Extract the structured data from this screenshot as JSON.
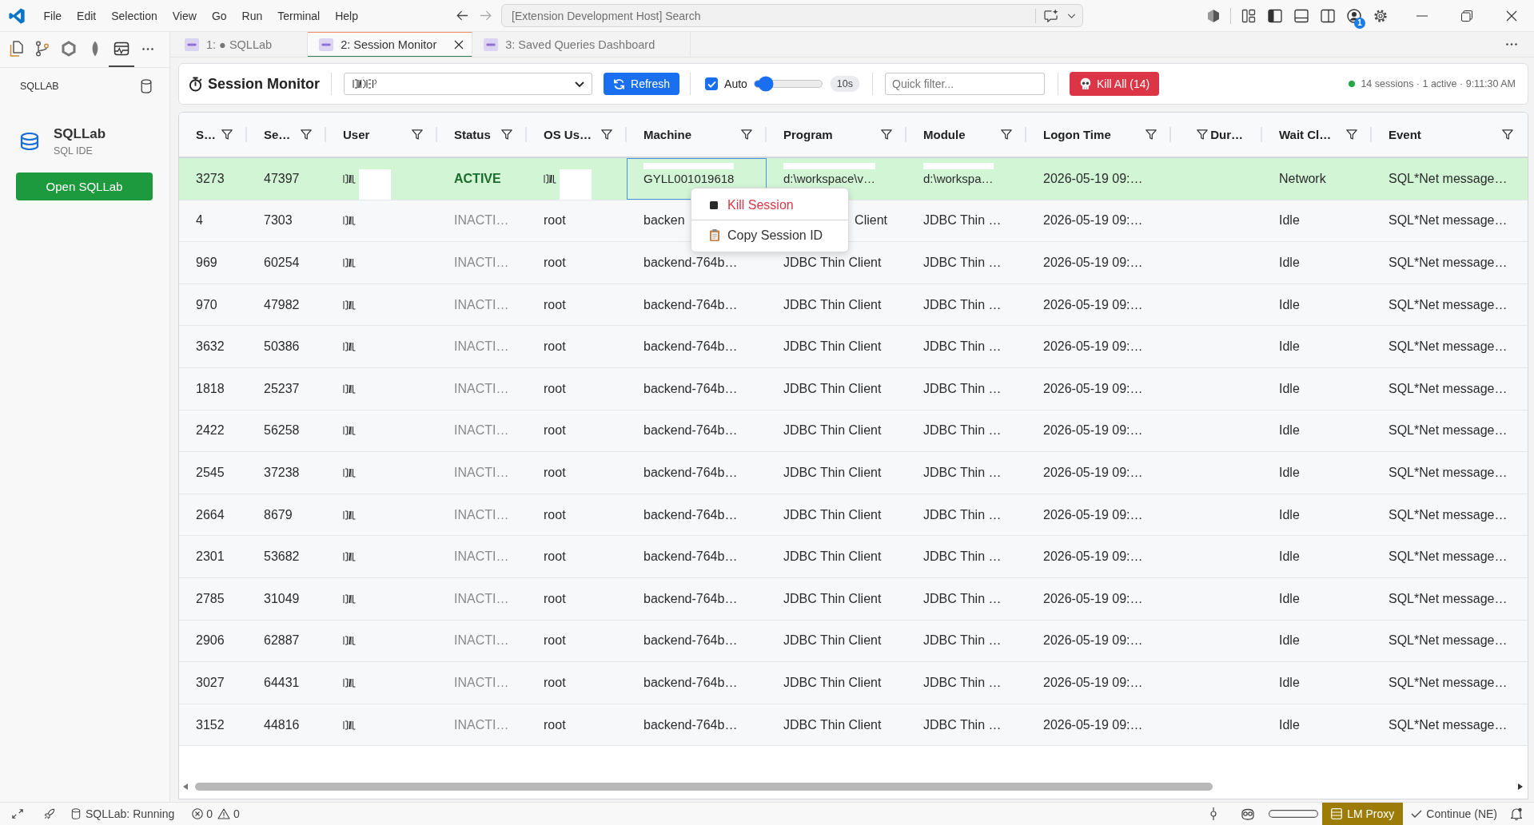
{
  "title_bar": {
    "menu": [
      "File",
      "Edit",
      "Selection",
      "View",
      "Go",
      "Run",
      "Terminal",
      "Help"
    ],
    "search": {
      "placeholder": "[Extension Development Host] Search"
    },
    "account_badge": "1"
  },
  "activity_bar": {
    "items": [
      {
        "kind": "files",
        "selected": false
      },
      {
        "kind": "source-control",
        "selected": false
      },
      {
        "kind": "hexagon",
        "selected": false
      },
      {
        "kind": "leaf",
        "selected": false
      },
      {
        "kind": "monitor",
        "selected": true
      },
      {
        "kind": "more",
        "selected": false
      }
    ]
  },
  "sidebar": {
    "section_title": "SQLLAB",
    "app_name": "SQLLab",
    "app_subtitle": "SQL IDE",
    "open_button": "Open SQLLab"
  },
  "tabs": [
    {
      "label": "1: ● SQLLab",
      "selected": false
    },
    {
      "label": "2: Session Monitor",
      "selected": true
    },
    {
      "label": "3: Saved Queries Dashboard",
      "selected": false
    }
  ],
  "toolbar": {
    "title": "Session Monitor",
    "connection_select": {
      "garbled": true
    },
    "refresh_button": "Refresh",
    "auto_refresh": {
      "label": "Auto",
      "checked": true,
      "level": 0.17,
      "interval": "10s"
    },
    "quick_filter": {
      "placeholder": "Quick filter..."
    },
    "kill_all_button": "Kill All (14)",
    "status": {
      "live": true,
      "text": "14 sessions · 1 active · 9:11:30 AM"
    }
  },
  "table": {
    "columns": [
      {
        "label": "S…",
        "kind": "text"
      },
      {
        "label": "Se…",
        "kind": "text"
      },
      {
        "label": "User",
        "kind": "text"
      },
      {
        "label": "Status",
        "kind": "status"
      },
      {
        "label": "OS Us…",
        "kind": "text"
      },
      {
        "label": "Machine",
        "kind": "text"
      },
      {
        "label": "Program",
        "kind": "text"
      },
      {
        "label": "Module",
        "kind": "text"
      },
      {
        "label": "Logon Time",
        "kind": "text"
      },
      {
        "label": "Dur…",
        "kind": "numeric"
      },
      {
        "label": "Wait Cl…",
        "kind": "text"
      },
      {
        "label": "Event",
        "kind": "text"
      }
    ],
    "rows": [
      {
        "active": true,
        "cells": [
          "3273",
          "47397",
          {
            "garbled": true,
            "redacted": true
          },
          "ACTIVE",
          {
            "garbled": true,
            "redacted": true
          },
          {
            "text": "GYLL001019618",
            "redacted": true,
            "focused": true
          },
          {
            "text": "d:\\workspace\\v…",
            "redacted": true
          },
          {
            "text": "d:\\workspa…",
            "redacted": true
          },
          "2026-05-19 09:…",
          null,
          "Network",
          "SQL*Net message…"
        ]
      },
      {
        "active": false,
        "cells": [
          "4",
          "7303",
          {
            "garbled": true
          },
          "INACTI…",
          "root",
          "backen",
          {
            "text": "Client",
            "hidden_start": true
          },
          "JDBC Thin …",
          "2026-05-19 09:…",
          null,
          "Idle",
          "SQL*Net message…"
        ]
      },
      {
        "active": false,
        "cells": [
          "969",
          "60254",
          {
            "garbled": true
          },
          "INACTI…",
          "root",
          "backend-764b…",
          "JDBC Thin Client",
          "JDBC Thin …",
          "2026-05-19 09:…",
          null,
          "Idle",
          "SQL*Net message…"
        ]
      },
      {
        "active": false,
        "cells": [
          "970",
          "47982",
          {
            "garbled": true
          },
          "INACTI…",
          "root",
          "backend-764b…",
          "JDBC Thin Client",
          "JDBC Thin …",
          "2026-05-19 09:…",
          null,
          "Idle",
          "SQL*Net message…"
        ]
      },
      {
        "active": false,
        "cells": [
          "3632",
          "50386",
          {
            "garbled": true
          },
          "INACTI…",
          "root",
          "backend-764b…",
          "JDBC Thin Client",
          "JDBC Thin …",
          "2026-05-19 09:…",
          null,
          "Idle",
          "SQL*Net message…"
        ]
      },
      {
        "active": false,
        "cells": [
          "1818",
          "25237",
          {
            "garbled": true
          },
          "INACTI…",
          "root",
          "backend-764b…",
          "JDBC Thin Client",
          "JDBC Thin …",
          "2026-05-19 09:…",
          null,
          "Idle",
          "SQL*Net message…"
        ]
      },
      {
        "active": false,
        "cells": [
          "2422",
          "56258",
          {
            "garbled": true
          },
          "INACTI…",
          "root",
          "backend-764b…",
          "JDBC Thin Client",
          "JDBC Thin …",
          "2026-05-19 09:…",
          null,
          "Idle",
          "SQL*Net message…"
        ]
      },
      {
        "active": false,
        "cells": [
          "2545",
          "37238",
          {
            "garbled": true
          },
          "INACTI…",
          "root",
          "backend-764b…",
          "JDBC Thin Client",
          "JDBC Thin …",
          "2026-05-19 09:…",
          null,
          "Idle",
          "SQL*Net message…"
        ]
      },
      {
        "active": false,
        "cells": [
          "2664",
          "8679",
          {
            "garbled": true
          },
          "INACTI…",
          "root",
          "backend-764b…",
          "JDBC Thin Client",
          "JDBC Thin …",
          "2026-05-19 09:…",
          null,
          "Idle",
          "SQL*Net message…"
        ]
      },
      {
        "active": false,
        "cells": [
          "2301",
          "53682",
          {
            "garbled": true
          },
          "INACTI…",
          "root",
          "backend-764b…",
          "JDBC Thin Client",
          "JDBC Thin …",
          "2026-05-19 09:…",
          null,
          "Idle",
          "SQL*Net message…"
        ]
      },
      {
        "active": false,
        "cells": [
          "2785",
          "31049",
          {
            "garbled": true
          },
          "INACTI…",
          "root",
          "backend-764b…",
          "JDBC Thin Client",
          "JDBC Thin …",
          "2026-05-19 09:…",
          null,
          "Idle",
          "SQL*Net message…"
        ]
      },
      {
        "active": false,
        "cells": [
          "2906",
          "62887",
          {
            "garbled": true
          },
          "INACTI…",
          "root",
          "backend-764b…",
          "JDBC Thin Client",
          "JDBC Thin …",
          "2026-05-19 09:…",
          null,
          "Idle",
          "SQL*Net message…"
        ]
      },
      {
        "active": false,
        "cells": [
          "3027",
          "64431",
          {
            "garbled": true
          },
          "INACTI…",
          "root",
          "backend-764b…",
          "JDBC Thin Client",
          "JDBC Thin …",
          "2026-05-19 09:…",
          null,
          "Idle",
          "SQL*Net message…"
        ]
      },
      {
        "active": false,
        "cells": [
          "3152",
          "44816",
          {
            "garbled": true
          },
          "INACTI…",
          "root",
          "backend-764b…",
          "JDBC Thin Client",
          "JDBC Thin …",
          "2026-05-19 09:…",
          null,
          "Idle",
          "SQL*Net message…"
        ]
      }
    ]
  },
  "context_menu": {
    "items": [
      {
        "kind": "danger",
        "label": "Kill Session"
      },
      {
        "kind": "copy",
        "label": "Copy Session ID"
      }
    ]
  },
  "status_bar": {
    "extension_status": "SQLLab: Running",
    "errors": "0",
    "warnings": "0",
    "lm_proxy": "LM Proxy",
    "continue": "Continue (NE)"
  }
}
